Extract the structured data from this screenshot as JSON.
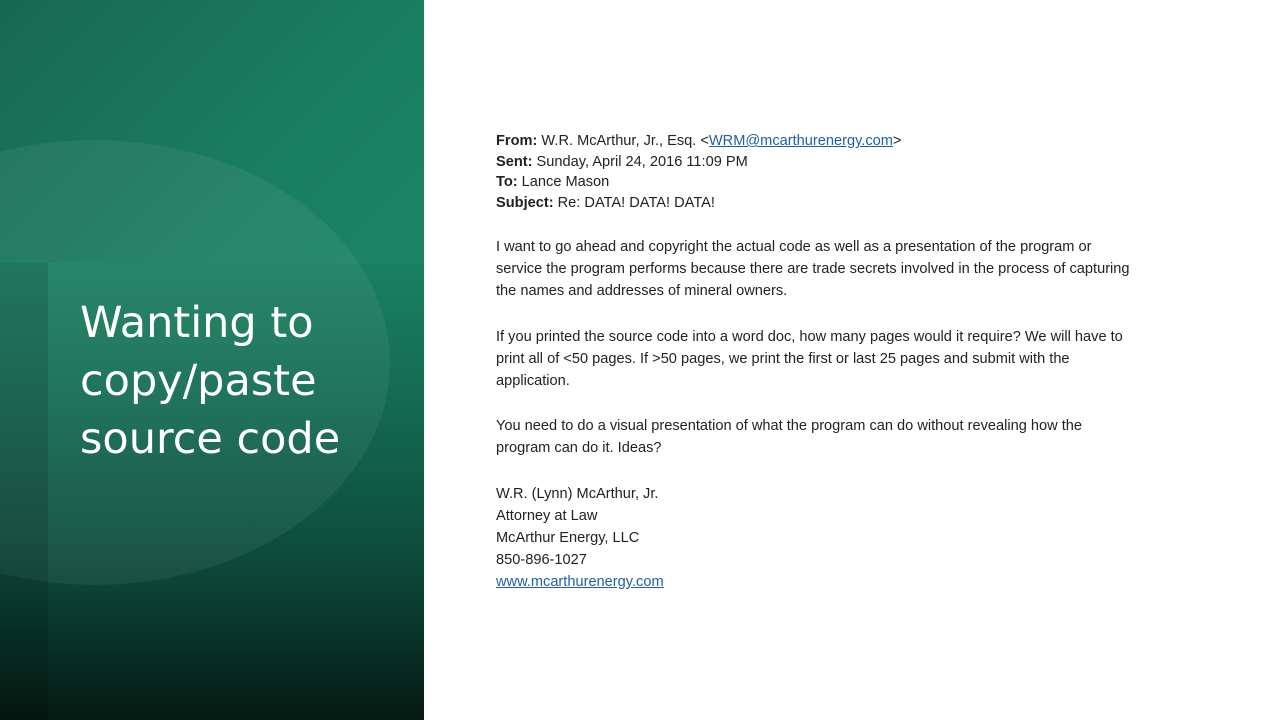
{
  "slide": {
    "title_lines": [
      "Wanting to",
      "copy/paste",
      "source code"
    ]
  },
  "email": {
    "from": {
      "label": "From:",
      "name": "W.R. McArthur, Jr., Esq. <",
      "email": "WRM@mcarthurenergy.com",
      "suffix": ">"
    },
    "sent": {
      "label": "Sent:",
      "value": "Sunday, April 24, 2016 11:09 PM"
    },
    "to": {
      "label": "To:",
      "value": "Lance Mason"
    },
    "subject": {
      "label": "Subject:",
      "value": "Re: DATA! DATA! DATA!"
    },
    "paragraphs": [
      [
        "I want to go ahead and copyright the actual code as well as a presentation of the program or",
        "service the program performs because there are trade secrets involved in the process of capturing",
        "the names and addresses of mineral owners."
      ],
      [
        "If you printed the source code into a word doc, how many pages would it require? We will have to",
        "print all of <50 pages. If >50 pages, we print the first or last 25 pages and submit with the",
        "application."
      ],
      [
        "You need to do a visual presentation of what the program can do without revealing how the",
        "program can do it. Ideas?"
      ]
    ],
    "signature": {
      "name": "W.R. (Lynn) McArthur, Jr.",
      "role": "Attorney at Law",
      "company": "McArthur Energy, LLC",
      "phone": "850-896-1027",
      "website": "www.mcarthurenergy.com"
    }
  },
  "colors": {
    "panel_green": "#1a7a5c",
    "panel_dark": "#06221a",
    "link_blue": "#1f5fa8",
    "text": "#222222"
  }
}
